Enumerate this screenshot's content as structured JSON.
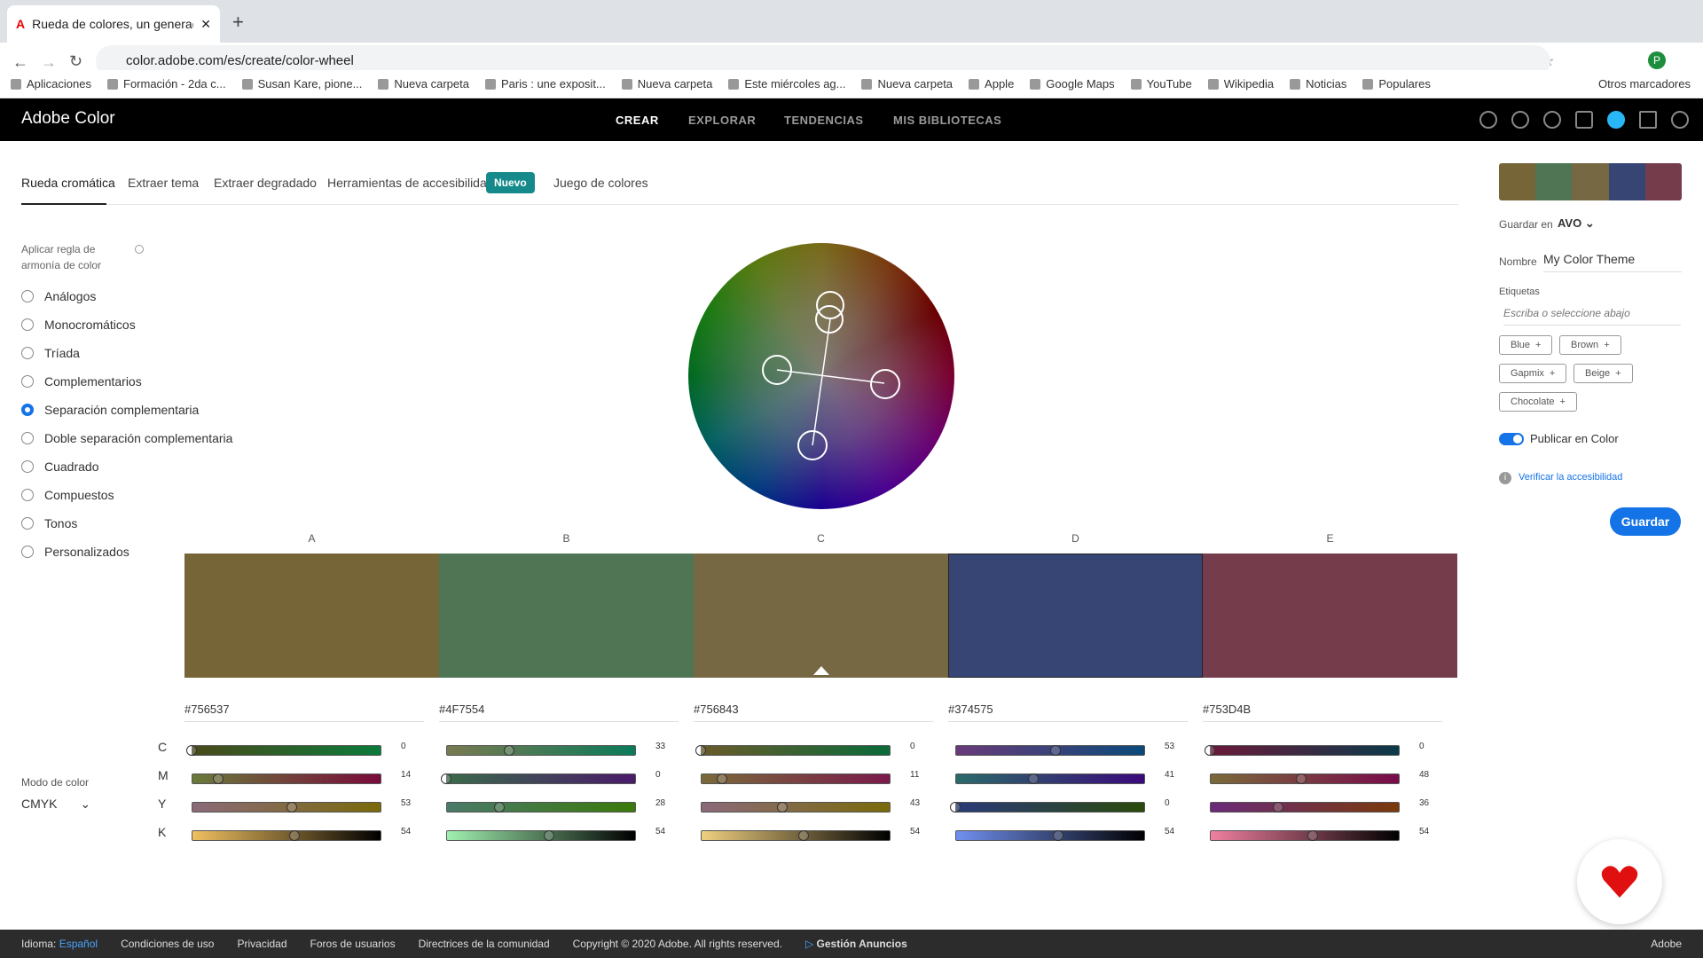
{
  "browser": {
    "tab_title": "Rueda de colores, un generad...",
    "url": "color.adobe.com/es/create/color-wheel",
    "bookmarks": [
      "Aplicaciones",
      "Formación - 2da c...",
      "Susan Kare, pione...",
      "Nueva carpeta",
      "Paris : une exposit...",
      "Nueva carpeta",
      "Este miércoles ag...",
      "Nueva carpeta",
      "Apple",
      "Google Maps",
      "YouTube",
      "Wikipedia",
      "Noticias",
      "Populares"
    ],
    "other_bookmarks": "Otros marcadores"
  },
  "header": {
    "logo": "Adobe Color",
    "nav": [
      "CREAR",
      "EXPLORAR",
      "TENDENCIAS",
      "MIS BIBLIOTECAS"
    ]
  },
  "subnav": {
    "tabs": [
      "Rueda cromática",
      "Extraer tema",
      "Extraer degradado",
      "Herramientas de accesibilidad",
      "Juego de colores"
    ],
    "badge": "Nuevo"
  },
  "harmony": {
    "heading": "Aplicar regla de armonía de color",
    "rules": [
      "Análogos",
      "Monocromáticos",
      "Tríada",
      "Complementarios",
      "Separación complementaria",
      "Doble separación complementaria",
      "Cuadrado",
      "Compuestos",
      "Tonos",
      "Personalizados"
    ],
    "selected": "Separación complementaria"
  },
  "swatches": [
    {
      "label": "A",
      "hex": "#756537",
      "color": "#756537",
      "cmyk": [
        0,
        14,
        53,
        54
      ]
    },
    {
      "label": "B",
      "hex": "#4F7554",
      "color": "#4F7554",
      "cmyk": [
        33,
        0,
        28,
        54
      ]
    },
    {
      "label": "C",
      "hex": "#756843",
      "color": "#756843",
      "cmyk": [
        0,
        11,
        43,
        54
      ]
    },
    {
      "label": "D",
      "hex": "#374575",
      "color": "#374575",
      "cmyk": [
        53,
        41,
        0,
        54
      ]
    },
    {
      "label": "E",
      "hex": "#753D4B",
      "color": "#753D4B",
      "cmyk": [
        0,
        48,
        36,
        54
      ]
    }
  ],
  "channel_labels": [
    "C",
    "M",
    "Y",
    "K"
  ],
  "color_mode": {
    "label": "Modo de color",
    "value": "CMYK"
  },
  "panel": {
    "save_in_label": "Guardar en",
    "save_in_value": "AVO",
    "name_label": "Nombre",
    "name_value": "My Color Theme",
    "tags_label": "Etiquetas",
    "tags_placeholder": "Escriba o seleccione abajo",
    "tags": [
      "Blue",
      "Brown",
      "Gapmix",
      "Beige",
      "Chocolate"
    ],
    "publish": "Publicar en Color",
    "verify": "Verificar la accesibilidad",
    "save": "Guardar"
  },
  "footer": {
    "lang_label": "Idioma:",
    "lang": "Español",
    "links": [
      "Condiciones de uso",
      "Privacidad",
      "Foros de usuarios",
      "Directrices de la comunidad",
      "Copyright © 2020 Adobe. All rights reserved."
    ],
    "ads": "Gestión Anuncios",
    "brand": "Adobe"
  }
}
